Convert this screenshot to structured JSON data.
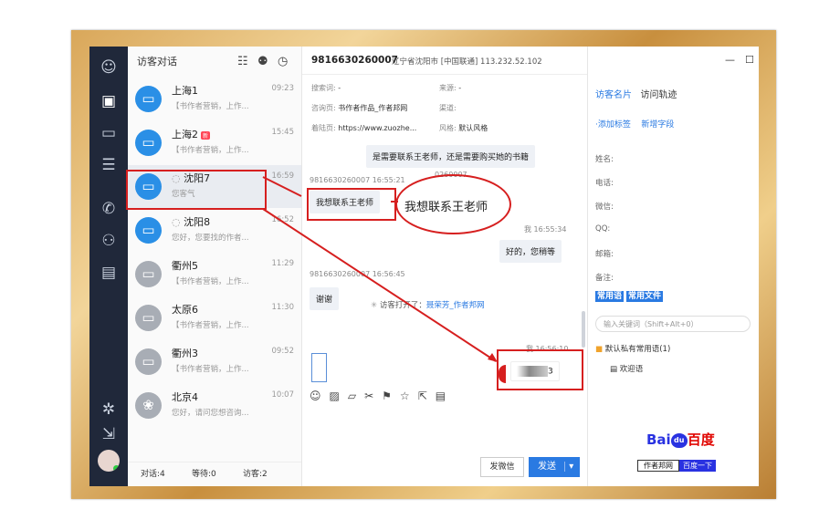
{
  "list": {
    "header": "访客对话",
    "items": [
      {
        "name": "上海1",
        "time": "09:23",
        "preview": "【书作者营销，上作...",
        "badge": ""
      },
      {
        "name": "上海2",
        "time": "15:45",
        "preview": "【书作者营销，上作...",
        "badge": "新"
      },
      {
        "name": "沈阳7",
        "time": "16:59",
        "preview": "您客气",
        "badge": ""
      },
      {
        "name": "沈阳8",
        "time": "16:52",
        "preview": "您好，您要找的作者...",
        "badge": ""
      },
      {
        "name": "衢州5",
        "time": "11:29",
        "preview": "【书作者营销，上作...",
        "badge": ""
      },
      {
        "name": "太原6",
        "time": "11:30",
        "preview": "【书作者营销，上作...",
        "badge": ""
      },
      {
        "name": "衢州3",
        "time": "09:52",
        "preview": "【书作者营销，上作...",
        "badge": ""
      },
      {
        "name": "北京4",
        "time": "10:07",
        "preview": "您好，请问您想咨询...",
        "badge": ""
      }
    ],
    "footer": {
      "dialogs": "对话:4",
      "waiting": "等待:0",
      "visitors": "访客:2"
    }
  },
  "chat": {
    "visitor_id": "9816630260007",
    "location": "辽宁省沈阳市 [中国联通]  113.232.52.102",
    "meta": [
      {
        "k": "搜索词:",
        "v": "-",
        "k2": "来源:",
        "v2": "-"
      },
      {
        "k": "咨询页:",
        "v": "书作者作品_作者邦网",
        "k2": "渠道:",
        "v2": ""
      },
      {
        "k": "着陆页:",
        "v": "https://www.zuozhe...",
        "k2": "风格:",
        "v2": "默认风格"
      }
    ],
    "messages": {
      "m1": "是需要联系王老师，还是需要购买她的书籍",
      "ts1": "9816630260007 16:55:21",
      "ts1b": "0260007",
      "m2": "我想联系王老师",
      "m2big": "我想联系王老师",
      "ts2": "我 16:55:34",
      "m3": "好的，您稍等",
      "ts3": "9816630260007 16:56:45",
      "m4": "谢谢",
      "sys_prefix": "访客打开了：",
      "sys_link": "聂荣芳_作者邦网",
      "ts4": "我 16:56:10",
      "m5": "3"
    },
    "buttons": {
      "wechat": "发微信",
      "send": "发送",
      "send_arrow": "▾"
    }
  },
  "right": {
    "tab_active": "访客名片",
    "tab_other": "访问轨迹",
    "link_tag": "·添加标签",
    "link_field": "新增字段",
    "fields": [
      "姓名:",
      "电话:",
      "微信:",
      "QQ:",
      "邮箱:",
      "备注:"
    ],
    "tab2_a": "常用语",
    "tab2_b": "常用文件",
    "keyword_placeholder": "输入关键词（Shift+Alt+0）",
    "folder": "默认私有常用语(1)",
    "sub": "欢迎语"
  },
  "baidu": {
    "text1": "Bai",
    "text2": "百度",
    "paw": "du",
    "tag_left": "作者邦网",
    "tag_right": "百度一下"
  },
  "colors": {
    "accent": "#2a7ae2",
    "nav": "#20283a",
    "annotation": "#d61f1f"
  }
}
